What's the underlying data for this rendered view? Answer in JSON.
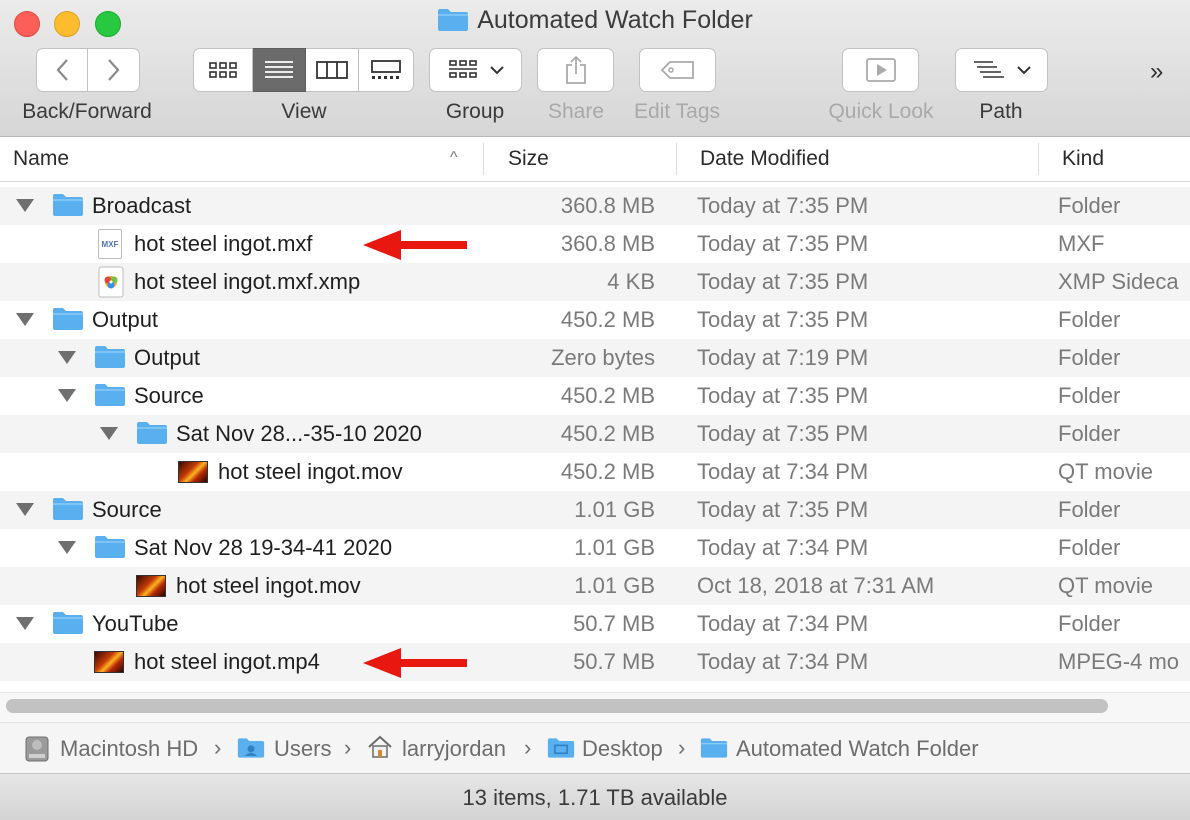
{
  "window": {
    "title": "Automated Watch Folder"
  },
  "toolbar": {
    "back_forward_label": "Back/Forward",
    "view_label": "View",
    "group_label": "Group",
    "share_label": "Share",
    "edit_tags_label": "Edit Tags",
    "quick_look_label": "Quick Look",
    "path_label": "Path",
    "overflow": "»"
  },
  "columns": {
    "name": "Name",
    "size": "Size",
    "date": "Date Modified",
    "kind": "Kind"
  },
  "rows": [
    {
      "name": "Broadcast",
      "size": "360.8 MB",
      "date": "Today at 7:35 PM",
      "kind": "Folder"
    },
    {
      "name": "hot steel ingot.mxf",
      "size": "360.8 MB",
      "date": "Today at 7:35 PM",
      "kind": "MXF",
      "icon_text": "MXF"
    },
    {
      "name": "hot steel ingot.mxf.xmp",
      "size": "4 KB",
      "date": "Today at 7:35 PM",
      "kind": "XMP Sideca"
    },
    {
      "name": "Output",
      "size": "450.2 MB",
      "date": "Today at 7:35 PM",
      "kind": "Folder"
    },
    {
      "name": "Output",
      "size": "Zero bytes",
      "date": "Today at 7:19 PM",
      "kind": "Folder"
    },
    {
      "name": "Source",
      "size": "450.2 MB",
      "date": "Today at 7:35 PM",
      "kind": "Folder"
    },
    {
      "name": "Sat Nov 28...-35-10 2020",
      "size": "450.2 MB",
      "date": "Today at 7:35 PM",
      "kind": "Folder"
    },
    {
      "name": "hot steel ingot.mov",
      "size": "450.2 MB",
      "date": "Today at 7:34 PM",
      "kind": "QT movie"
    },
    {
      "name": "Source",
      "size": "1.01 GB",
      "date": "Today at 7:35 PM",
      "kind": "Folder"
    },
    {
      "name": "Sat Nov 28 19-34-41 2020",
      "size": "1.01 GB",
      "date": "Today at 7:34 PM",
      "kind": "Folder"
    },
    {
      "name": "hot steel ingot.mov",
      "size": "1.01 GB",
      "date": "Oct 18, 2018 at 7:31 AM",
      "kind": "QT movie"
    },
    {
      "name": "YouTube",
      "size": "50.7 MB",
      "date": "Today at 7:34 PM",
      "kind": "Folder"
    },
    {
      "name": "hot steel ingot.mp4",
      "size": "50.7 MB",
      "date": "Today at 7:34 PM",
      "kind": "MPEG-4 mo"
    }
  ],
  "pathbar": {
    "items": [
      "Macintosh HD",
      "Users",
      "larryjordan",
      "Desktop",
      "Automated Watch Folder"
    ],
    "separator": "›"
  },
  "status": {
    "text": "13 items, 1.71 TB available"
  },
  "colors": {
    "folder": "#5ab0ee",
    "arrow": "#e8170f",
    "active_view": "#6b6b6b"
  }
}
